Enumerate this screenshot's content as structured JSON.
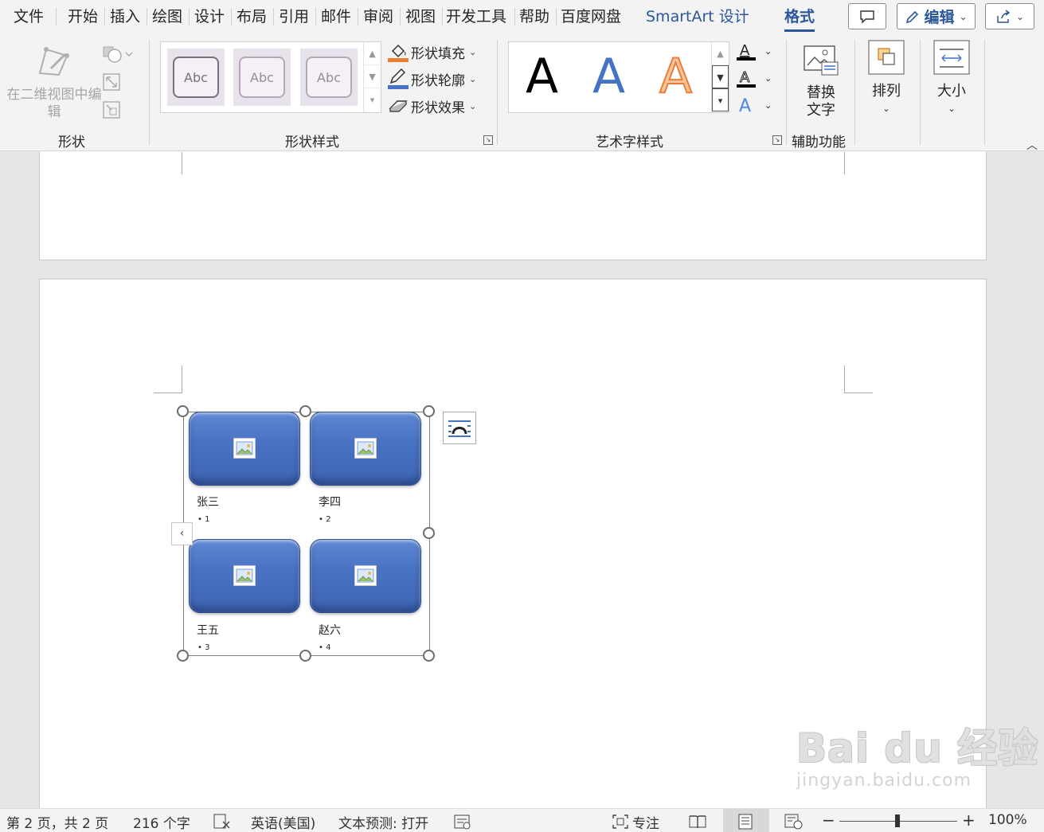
{
  "tabs": [
    {
      "label": "文件"
    },
    {
      "label": "开始"
    },
    {
      "label": "插入"
    },
    {
      "label": "绘图"
    },
    {
      "label": "设计"
    },
    {
      "label": "布局"
    },
    {
      "label": "引用"
    },
    {
      "label": "邮件"
    },
    {
      "label": "审阅"
    },
    {
      "label": "视图"
    },
    {
      "label": "开发工具"
    },
    {
      "label": "帮助"
    },
    {
      "label": "百度网盘"
    },
    {
      "label": "SmartArt 设计"
    },
    {
      "label": "格式"
    }
  ],
  "topbar": {
    "edit_label": "编辑"
  },
  "ribbon": {
    "shape_group": {
      "edit_2d_label": "在二维视图中编辑",
      "label": "形状"
    },
    "shape_styles": {
      "label": "形状样式",
      "gallery": [
        "Abc",
        "Abc",
        "Abc"
      ],
      "fill": "形状填充",
      "outline": "形状轮廓",
      "effects": "形状效果"
    },
    "wordart_styles": {
      "label": "艺术字样式",
      "gallery": [
        "A",
        "A",
        "A"
      ]
    },
    "accessibility": {
      "label": "辅助功能",
      "alt_text": "替换文字"
    },
    "arrange": {
      "label": "排列"
    },
    "size": {
      "label": "大小"
    }
  },
  "smartart": {
    "items": [
      {
        "name": "张三",
        "bullet": "• 1"
      },
      {
        "name": "李四",
        "bullet": "• 2"
      },
      {
        "name": "王五",
        "bullet": "• 3"
      },
      {
        "name": "赵六",
        "bullet": "• 4"
      }
    ]
  },
  "watermark": {
    "main": "Bai du 经验",
    "sub": "jingyan.baidu.com"
  },
  "status": {
    "page": "第 2 页，共 2 页",
    "words": "216 个字",
    "language": "英语(美国)",
    "prediction": "文本预测: 打开",
    "focus": "专注",
    "zoom": "100%"
  },
  "colors": {
    "accent": "#2b579a",
    "tile_blue": "#4a73c4",
    "fill_orange": "#ed7d31",
    "outline_blue": "#4472c4"
  }
}
